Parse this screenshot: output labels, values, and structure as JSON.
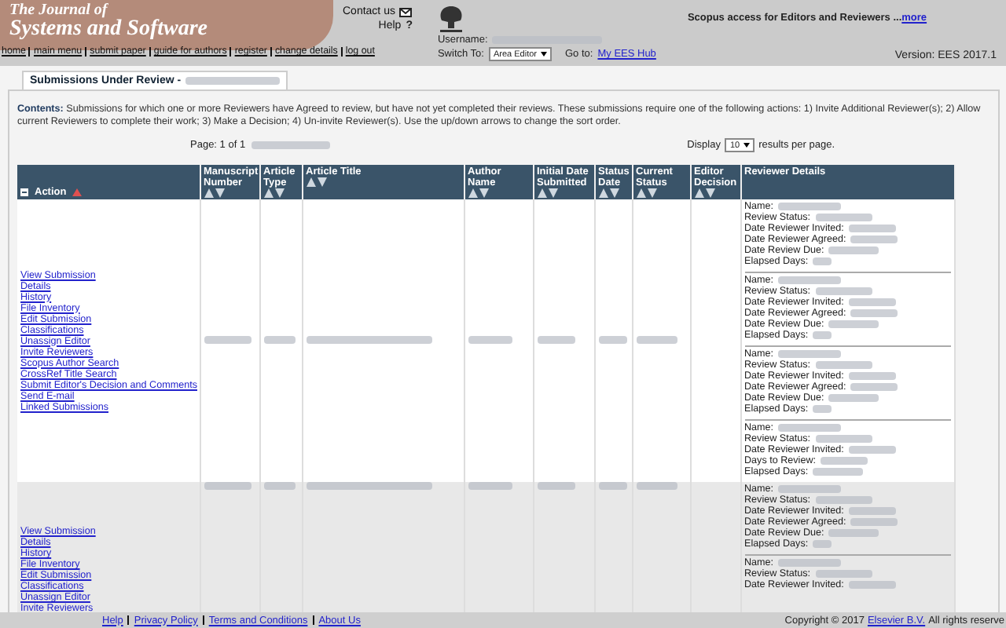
{
  "header": {
    "journal_title": [
      "The Journal of",
      "Systems and Software"
    ],
    "contact": "Contact us",
    "help": "Help",
    "help_icon": "?",
    "scopus_text": "Scopus access for Editors and Reviewers ...",
    "scopus_link": "more",
    "username_label": "Username:",
    "switch_label": "Switch To:",
    "role_select": "Area Editor",
    "goto_label": "Go to:",
    "hub_link": "My EES Hub",
    "version": "Version: EES 2017.1"
  },
  "nav": [
    "home",
    "main menu",
    "submit paper",
    "guide for authors",
    "register",
    "change details",
    "log out"
  ],
  "tabs": [
    {
      "label": "Submissions Under Review -",
      "selected": true
    }
  ],
  "contents": {
    "label": "Contents:",
    "text": "Submissions for which one or more Reviewers have Agreed to review, but have not yet completed their reviews. These submissions require one of the following actions: 1) Invite Additional Reviewer(s); 2) Allow current Reviewers to complete their work; 3) Make a Decision; 4) Un-invite Reviewer(s). Use the up/down arrows to change the sort order."
  },
  "pager": {
    "page": "Page: 1 of 1",
    "display": "Display",
    "per_page": "10",
    "results": "results per page."
  },
  "table": {
    "columns": [
      "Action",
      "Manuscript Number",
      "Article Type",
      "Article Title",
      "Author Name",
      "Initial Date Submitted",
      "Status Date",
      "Current Status",
      "Editor Decision",
      "Reviewer Details"
    ],
    "rows": [
      {
        "actions": [
          "View Submission",
          "Details",
          "History",
          "File Inventory",
          "Edit Submission",
          "Classifications",
          "Unassign Editor",
          "Invite Reviewers",
          "Scopus Author Search",
          "CrossRef Title Search",
          "Submit Editor's Decision and Comments",
          "Send E-mail",
          "Linked Submissions"
        ],
        "reviewers": [
          {
            "fields": [
              "Name:",
              "Review Status:",
              "Date Reviewer Invited:",
              "Date Reviewer Agreed:",
              "Date Review Due:",
              "Elapsed Days:"
            ]
          },
          {
            "fields": [
              "Name:",
              "Review Status:",
              "Date Reviewer Invited:",
              "Date Reviewer Agreed:",
              "Date Review Due:",
              "Elapsed Days:"
            ]
          },
          {
            "fields": [
              "Name:",
              "Review Status:",
              "Date Reviewer Invited:",
              "Date Reviewer Agreed:",
              "Date Review Due:",
              "Elapsed Days:"
            ]
          },
          {
            "fields": [
              "Name:",
              "Review Status:",
              "Date Reviewer Invited:",
              "Days to Review:",
              "Elapsed Days:"
            ]
          }
        ]
      },
      {
        "actions": [
          "View Submission",
          "Details",
          "History",
          "File Inventory",
          "Edit Submission",
          "Classifications",
          "Unassign Editor",
          "Invite Reviewers"
        ],
        "reviewers": [
          {
            "fields": [
              "Name:",
              "Review Status:",
              "Date Reviewer Invited:",
              "Date Reviewer Agreed:",
              "Date Review Due:",
              "Elapsed Days:"
            ]
          },
          {
            "fields": [
              "Name:",
              "Review Status:",
              "Date Reviewer Invited:"
            ]
          }
        ]
      }
    ]
  },
  "footer": {
    "links": [
      "Help",
      "Privacy Policy",
      "Terms and Conditions",
      "About Us"
    ],
    "copyright": "Copyright © 2017",
    "company_link": "Elsevier B.V.",
    "rights": "All rights reserve"
  }
}
